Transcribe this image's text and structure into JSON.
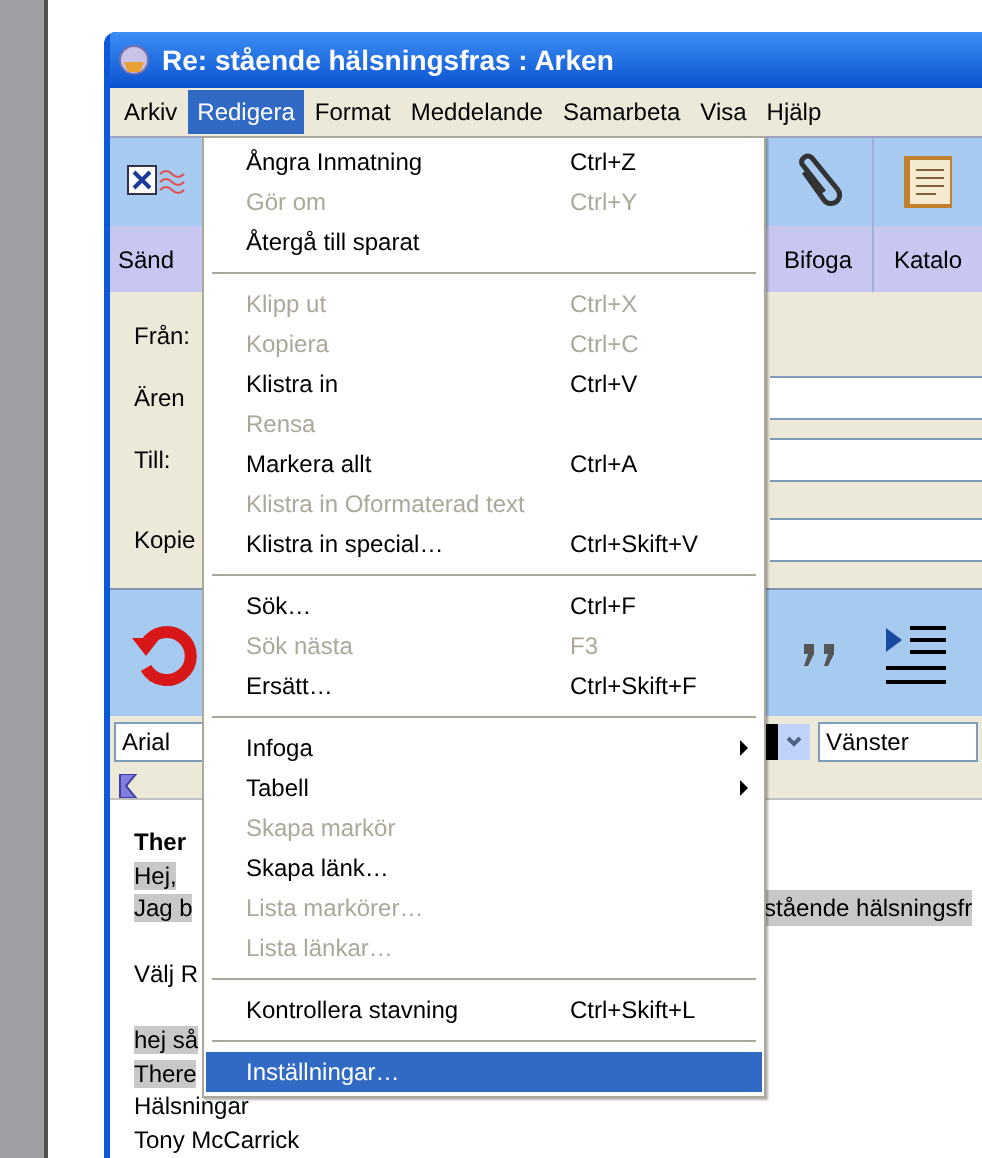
{
  "window": {
    "title": "Re: stående hälsningsfras : Arken"
  },
  "menu_bar": [
    {
      "label": "Arkiv",
      "selected": false
    },
    {
      "label": "Redigera",
      "selected": true
    },
    {
      "label": "Format",
      "selected": false
    },
    {
      "label": "Meddelande",
      "selected": false
    },
    {
      "label": "Samarbeta",
      "selected": false
    },
    {
      "label": "Visa",
      "selected": false
    },
    {
      "label": "Hjälp",
      "selected": false
    }
  ],
  "edit_menu": [
    {
      "kind": "item",
      "label": "Ångra Inmatning",
      "shortcut": "Ctrl+Z",
      "disabled": false,
      "selected": false
    },
    {
      "kind": "item",
      "label": "Gör om",
      "shortcut": "Ctrl+Y",
      "disabled": true,
      "selected": false
    },
    {
      "kind": "item",
      "label": "Återgå till sparat",
      "disabled": false,
      "selected": false
    },
    {
      "kind": "separator"
    },
    {
      "kind": "item",
      "label": "Klipp ut",
      "shortcut": "Ctrl+X",
      "disabled": true,
      "selected": false
    },
    {
      "kind": "item",
      "label": "Kopiera",
      "shortcut": "Ctrl+C",
      "disabled": true,
      "selected": false
    },
    {
      "kind": "item",
      "label": "Klistra in",
      "shortcut": "Ctrl+V",
      "disabled": false,
      "selected": false
    },
    {
      "kind": "item",
      "label": "Rensa",
      "disabled": true,
      "selected": false
    },
    {
      "kind": "item",
      "label": "Markera allt",
      "shortcut": "Ctrl+A",
      "disabled": false,
      "selected": false
    },
    {
      "kind": "item",
      "label": "Klistra in Oformaterad text",
      "disabled": true,
      "selected": false
    },
    {
      "kind": "item",
      "label": "Klistra in special…",
      "shortcut": "Ctrl+Skift+V",
      "disabled": false,
      "selected": false
    },
    {
      "kind": "separator"
    },
    {
      "kind": "item",
      "label": "Sök…",
      "shortcut": "Ctrl+F",
      "disabled": false,
      "selected": false
    },
    {
      "kind": "item",
      "label": "Sök nästa",
      "shortcut": "F3",
      "disabled": true,
      "selected": false
    },
    {
      "kind": "item",
      "label": "Ersätt…",
      "shortcut": "Ctrl+Skift+F",
      "disabled": false,
      "selected": false
    },
    {
      "kind": "separator"
    },
    {
      "kind": "submenu",
      "label": "Infoga",
      "disabled": false,
      "selected": false
    },
    {
      "kind": "submenu",
      "label": "Tabell",
      "disabled": false,
      "selected": false
    },
    {
      "kind": "item",
      "label": "Skapa markör",
      "disabled": true,
      "selected": false
    },
    {
      "kind": "item",
      "label": "Skapa länk…",
      "disabled": false,
      "selected": false
    },
    {
      "kind": "item",
      "label": "Lista markörer…",
      "disabled": true,
      "selected": false
    },
    {
      "kind": "item",
      "label": "Lista länkar…",
      "disabled": true,
      "selected": false
    },
    {
      "kind": "separator"
    },
    {
      "kind": "item",
      "label": "Kontrollera stavning",
      "shortcut": "Ctrl+Skift+L",
      "disabled": false,
      "selected": false
    },
    {
      "kind": "separator"
    },
    {
      "kind": "item",
      "label": "Inställningar…",
      "disabled": false,
      "selected": true
    }
  ],
  "toolbar": {
    "left_buttons": [
      "Sänd"
    ],
    "right_buttons": [
      "Bifoga",
      "Katalo"
    ]
  },
  "header_fields": [
    {
      "label": "Från:"
    },
    {
      "label": "Ären"
    },
    {
      "label": "Till:"
    },
    {
      "label": "Kopie"
    }
  ],
  "format_bar": {
    "font": "Arial",
    "alignment": "Vänster"
  },
  "message_lines": [
    {
      "kind": "text",
      "text": "Ther",
      "bold": true,
      "highlighted": false
    },
    {
      "kind": "text",
      "text": "Hej,",
      "bold": false,
      "highlighted": true
    },
    {
      "kind": "text",
      "text": "Jag b",
      "right_text": "stående hälsningsfr",
      "bold": false,
      "highlighted": true
    },
    {
      "kind": "blank"
    },
    {
      "kind": "text",
      "text": "Välj R",
      "bold": false,
      "highlighted": false
    },
    {
      "kind": "blank"
    },
    {
      "kind": "text",
      "text": "hej så",
      "bold": false,
      "highlighted": true
    },
    {
      "kind": "text",
      "text": "There",
      "bold": false,
      "highlighted": true
    },
    {
      "kind": "text",
      "text": "Hälsningar",
      "bold": false,
      "highlighted": false
    },
    {
      "kind": "text",
      "text": "Tony McCarrick",
      "bold": false,
      "highlighted": false
    }
  ]
}
